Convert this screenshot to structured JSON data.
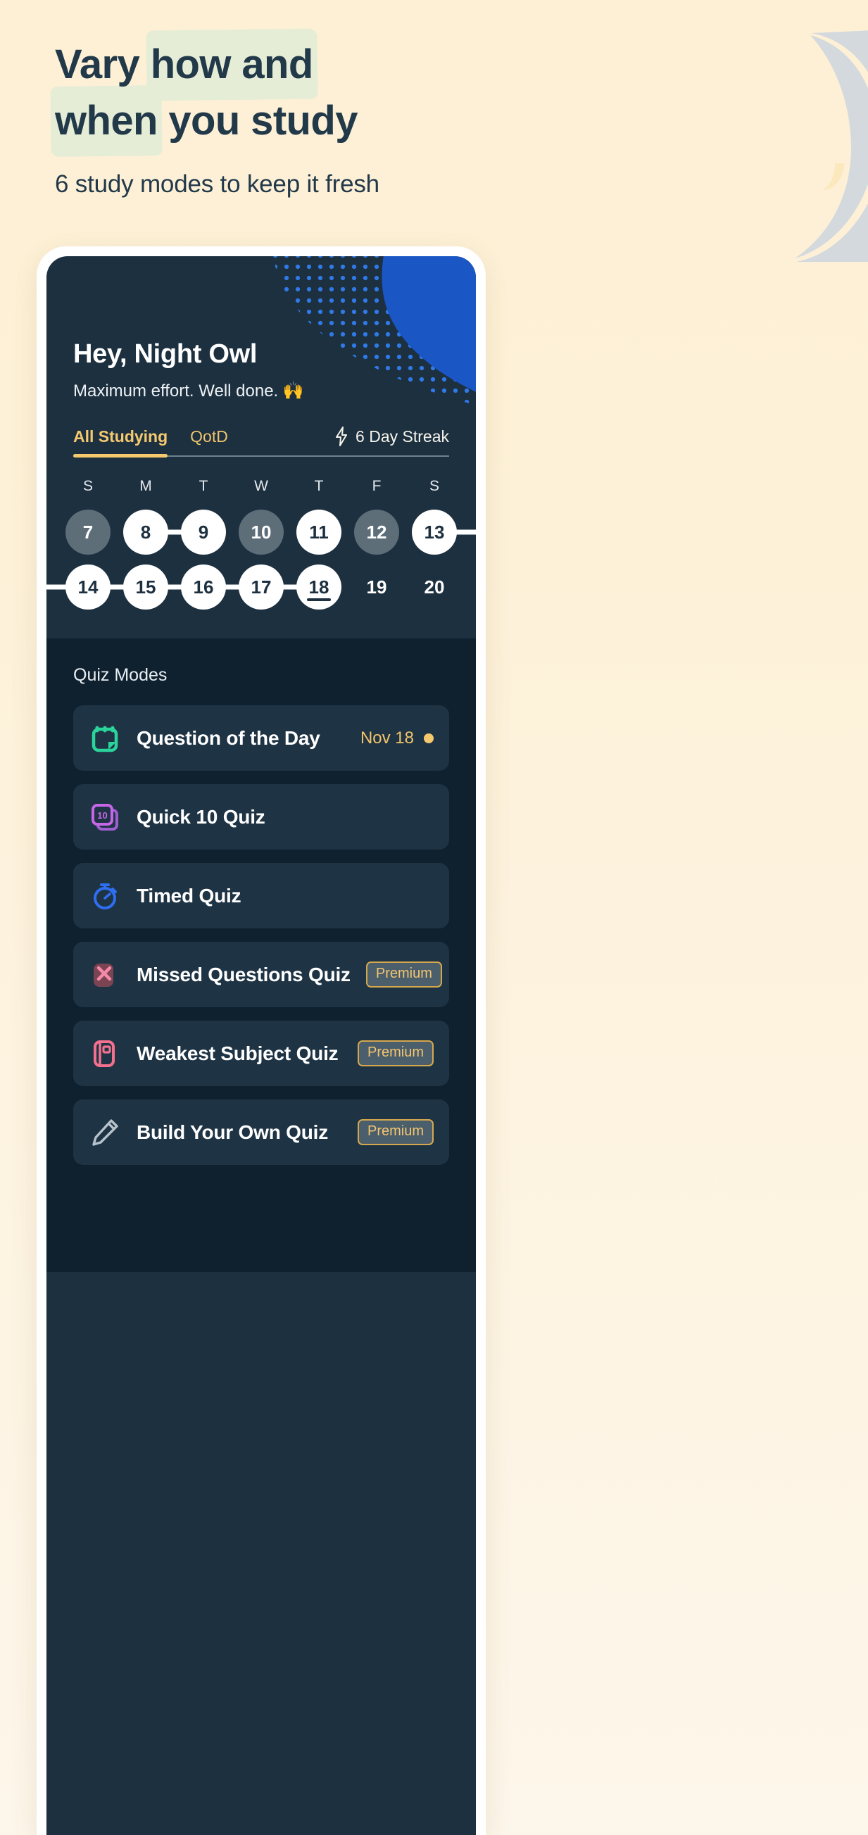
{
  "marketing": {
    "headline_line1_pre": "Vary ",
    "headline_line1_hl": "how and",
    "headline_line2_hl": "when",
    "headline_line2_post": " you study",
    "subheadline": "6 study modes to keep it fresh",
    "decor_icon": "crescent-moon-icon"
  },
  "colors": {
    "page_bg": "#fdf1d8",
    "headline_text": "#22394a",
    "highlight": "#e6edd6",
    "screen_bg": "#1d3040",
    "quiz_panel_bg": "#0f212e",
    "quiz_row_bg": "#1e3344",
    "accent_gold": "#f4c96e",
    "blob_blue": "#1a56c4",
    "moon_grey": "#d3d8dc"
  },
  "app": {
    "greeting_title": "Hey, Night Owl",
    "greeting_subtitle": "Maximum effort. Well done. 🙌",
    "tabs": [
      {
        "label": "All Studying",
        "active": true
      },
      {
        "label": "QotD",
        "active": false
      }
    ],
    "streak": {
      "icon": "lightning-bolt-icon",
      "label": "6 Day Streak"
    },
    "calendar": {
      "day_initials": [
        "S",
        "M",
        "T",
        "W",
        "T",
        "F",
        "S"
      ],
      "weeks": [
        [
          {
            "day": "7",
            "state": "missed"
          },
          {
            "day": "8",
            "state": "filled"
          },
          {
            "day": "9",
            "state": "filled"
          },
          {
            "day": "10",
            "state": "missed"
          },
          {
            "day": "11",
            "state": "filled"
          },
          {
            "day": "12",
            "state": "missed"
          },
          {
            "day": "13",
            "state": "filled"
          }
        ],
        [
          {
            "day": "14",
            "state": "filled"
          },
          {
            "day": "15",
            "state": "filled"
          },
          {
            "day": "16",
            "state": "filled"
          },
          {
            "day": "17",
            "state": "filled"
          },
          {
            "day": "18",
            "state": "filled",
            "today": true
          },
          {
            "day": "19",
            "state": "future"
          },
          {
            "day": "20",
            "state": "future"
          }
        ]
      ]
    },
    "quiz_modes": {
      "section_title": "Quiz Modes",
      "items": [
        {
          "label": "Question of the Day",
          "icon": "calendar-icon",
          "icon_color": "#2bd49b",
          "date": "Nov 18",
          "dot": true,
          "premium": false
        },
        {
          "label": "Quick 10 Quiz",
          "icon": "stacked-cards-10-icon",
          "icon_color": "#c766e8",
          "icon_text": "10",
          "premium": false
        },
        {
          "label": "Timed Quiz",
          "icon": "stopwatch-icon",
          "icon_color": "#2f6ef0",
          "premium": false
        },
        {
          "label": "Missed Questions Quiz",
          "icon": "x-mark-icon",
          "icon_color": "#f07a9a",
          "premium": true,
          "premium_label": "Premium"
        },
        {
          "label": "Weakest Subject Quiz",
          "icon": "book-icon",
          "icon_color": "#f4708f",
          "premium": true,
          "premium_label": "Premium"
        },
        {
          "label": "Build Your Own Quiz",
          "icon": "pencil-icon",
          "icon_color": "#b7c2cb",
          "premium": true,
          "premium_label": "Premium"
        }
      ]
    }
  }
}
